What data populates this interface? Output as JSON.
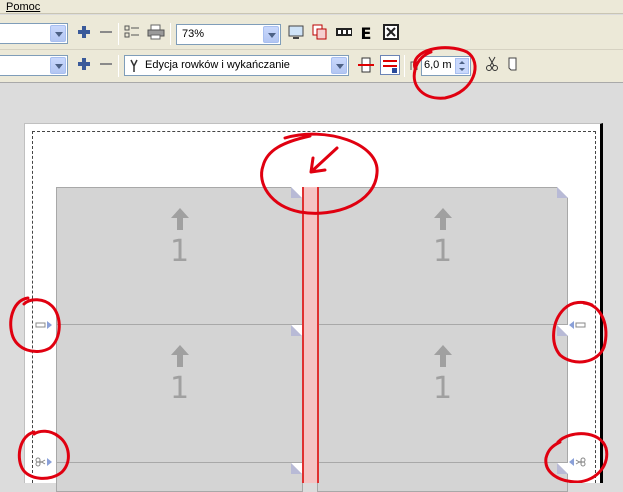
{
  "menu": {
    "help_label": "Pomoc"
  },
  "toolbar1": {
    "zoom_value": "73%",
    "add_icon": "plus-icon",
    "remove_icon": "minus-icon",
    "print_icon": "printer-icon",
    "text_button": "E"
  },
  "toolbar2": {
    "mode_select_value": "Edycja rowków i wykańczanie",
    "gap_value": "6,0 m"
  },
  "layout": {
    "panels": [
      {
        "label": "1"
      },
      {
        "label": "1"
      },
      {
        "label": "1"
      },
      {
        "label": "1"
      }
    ]
  },
  "colors": {
    "gap_fill": "#f4c4c4",
    "gap_border": "#e03030",
    "annotation_red": "#e00010",
    "panel_gray": "#d4d4d4"
  }
}
